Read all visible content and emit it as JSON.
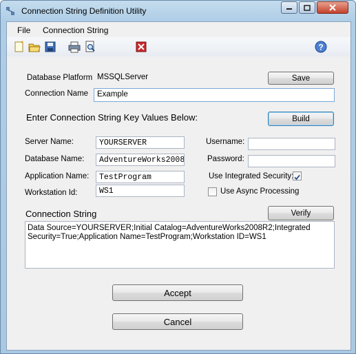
{
  "window": {
    "title": "Connection String Definition Utility"
  },
  "menu": {
    "file": "File",
    "connection_string": "Connection String"
  },
  "toolbar": {
    "icons": [
      "new-file-icon",
      "open-folder-icon",
      "save-icon",
      "print-icon",
      "print-preview-icon",
      "exit-icon",
      "help-icon"
    ]
  },
  "form": {
    "database_platform_label": "Database Platform",
    "database_platform_value": "MSSQLServer",
    "save_label": "Save",
    "connection_name_label": "Connection Name",
    "connection_name_value": "Example",
    "section_heading": "Enter Connection String Key Values Below:",
    "build_label": "Build",
    "server_name_label": "Server Name:",
    "server_name_value": "YOURSERVER",
    "database_name_label": "Database Name:",
    "database_name_value": "AdventureWorks2008",
    "application_name_label": "Application Name:",
    "application_name_value": "TestProgram",
    "workstation_id_label": "Workstation Id:",
    "workstation_id_value": "WS1",
    "username_label": "Username:",
    "username_value": "",
    "password_label": "Password:",
    "password_value": "",
    "integrated_security_label": "Use Integrated Security:",
    "integrated_security_checked": true,
    "async_label": "Use Async Processing",
    "async_checked": false,
    "connection_string_heading": "Connection String",
    "verify_label": "Verify",
    "connection_string_value": "Data Source=YOURSERVER;Initial Catalog=AdventureWorks2008R2;Integrated Security=True;Application Name=TestProgram;Workstation ID=WS1",
    "accept_label": "Accept",
    "cancel_label": "Cancel"
  }
}
